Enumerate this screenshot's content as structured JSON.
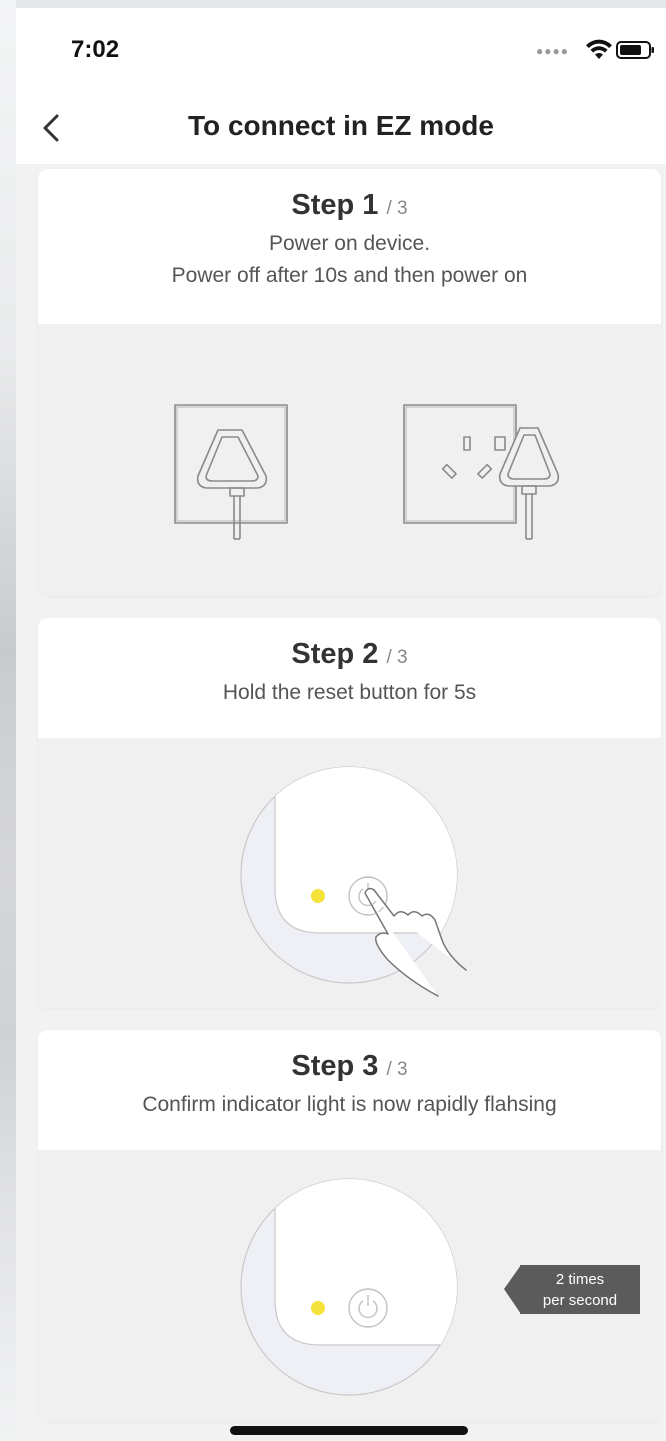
{
  "status_bar": {
    "time": "7:02",
    "signal_icon": "signal-dots-icon",
    "wifi_icon": "wifi-icon",
    "battery_icon": "battery-icon"
  },
  "nav": {
    "back_icon": "chevron-left-icon",
    "title": "To connect in EZ mode"
  },
  "steps": [
    {
      "label": "Step",
      "number": "1",
      "total": "/ 3",
      "description_lines": [
        "Power on device.",
        "Power off after 10s and then power on"
      ]
    },
    {
      "label": "Step",
      "number": "2",
      "total": "/ 3",
      "description_lines": [
        "Hold the reset button for 5s"
      ]
    },
    {
      "label": "Step",
      "number": "3",
      "total": "/ 3",
      "description_lines": [
        "Confirm indicator light is now rapidly flahsing"
      ],
      "tooltip": {
        "line1": "2 times",
        "line2": "per second"
      }
    }
  ],
  "colors": {
    "indicator_light": "#f5e23a",
    "tooltip_bg": "#5b5b5b",
    "card_bg": "#f0f0f1",
    "header_bg": "#ffffff"
  }
}
